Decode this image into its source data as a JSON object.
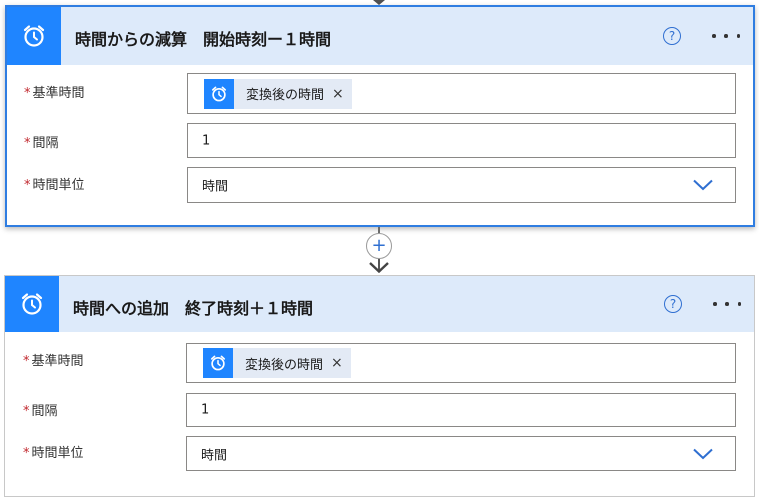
{
  "actions": [
    {
      "title": "時間からの減算　開始時刻ー１時間",
      "icon": "alarm-clock-icon",
      "help_symbol": "?",
      "fields": {
        "base_time": {
          "label": "基準時間",
          "required_marker": "*",
          "token_label": "変換後の時間",
          "token_icon": "alarm-clock-icon",
          "token_remove": "×"
        },
        "interval": {
          "label": "間隔",
          "required_marker": "*",
          "value": "1"
        },
        "time_unit": {
          "label": "時間単位",
          "required_marker": "*",
          "value": "時間"
        }
      }
    },
    {
      "title": "時間への追加　終了時刻＋１時間",
      "icon": "alarm-clock-icon",
      "help_symbol": "?",
      "fields": {
        "base_time": {
          "label": "基準時間",
          "required_marker": "*",
          "token_label": "変換後の時間",
          "token_icon": "alarm-clock-icon",
          "token_remove": "×"
        },
        "interval": {
          "label": "間隔",
          "required_marker": "*",
          "value": "1"
        },
        "time_unit": {
          "label": "時間単位",
          "required_marker": "*",
          "value": "時間"
        }
      }
    }
  ],
  "connector": {
    "add_symbol": "+"
  },
  "colors": {
    "accent": "#1f85ff",
    "header_bg": "#ddeafa",
    "selected_border": "#2f7de1",
    "required": "#c1272d",
    "token_bg": "#e3eaf5"
  }
}
